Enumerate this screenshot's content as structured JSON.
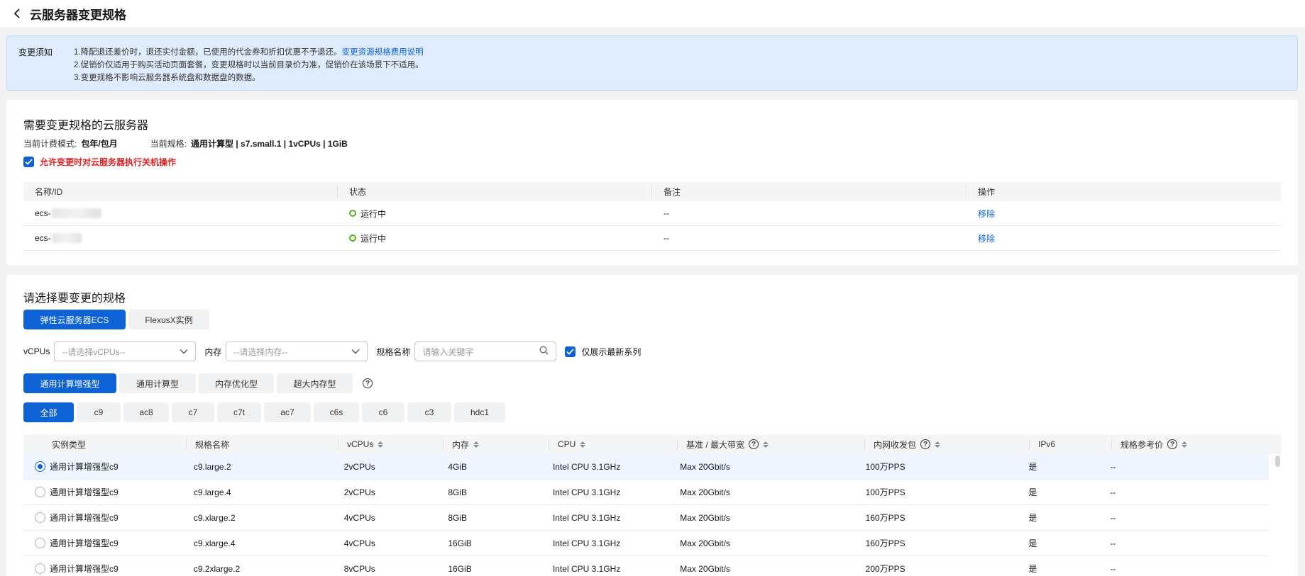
{
  "header": {
    "title": "云服务器变更规格"
  },
  "notice": {
    "label": "变更须知",
    "line1": "1.降配退还差价时，退还实付金额，已使用的代金券和折扣优惠不予退还。",
    "line1_link": "变更资源规格费用说明",
    "line2": "2.促销价仅适用于购买活动页面套餐，变更规格时以当前目录价为准，促销价在该场景下不适用。",
    "line3": "3.变更规格不影响云服务器系统盘和数据盘的数据。"
  },
  "servers_section": {
    "title": "需要变更规格的云服务器",
    "billing_label": "当前计费模式:",
    "billing_value": "包年/包月",
    "spec_label": "当前规格:",
    "spec_value": "通用计算型 | s7.small.1 | 1vCPUs | 1GiB",
    "allow_shutdown": "允许变更时对云服务器执行关机操作",
    "columns": [
      "名称/ID",
      "状态",
      "备注",
      "操作"
    ],
    "rows": [
      {
        "name": "ecs-",
        "status": "运行中",
        "remark": "--",
        "action": "移除"
      },
      {
        "name": "ecs-",
        "status": "运行中",
        "remark": "--",
        "action": "移除"
      }
    ]
  },
  "spec_section": {
    "title": "请选择要变更的规格",
    "product_tabs": [
      "弹性云服务器ECS",
      "FlexusX实例"
    ],
    "filters": {
      "vcpu_label": "vCPUs",
      "vcpu_placeholder": "--请选择vCPUs--",
      "memory_label": "内存",
      "memory_placeholder": "--请选择内存--",
      "name_label": "规格名称",
      "name_placeholder": "请输入关键字",
      "latest_only": "仅展示最新系列"
    },
    "type_tabs": [
      "通用计算增强型",
      "通用计算型",
      "内存优化型",
      "超大内存型"
    ],
    "series_tabs": [
      "全部",
      "c9",
      "ac8",
      "c7",
      "c7t",
      "ac7",
      "c6s",
      "c6",
      "c3",
      "hdc1"
    ],
    "columns": [
      "实例类型",
      "规格名称",
      "vCPUs",
      "内存",
      "CPU",
      "基准 / 最大带宽",
      "内网收发包",
      "IPv6",
      "规格参考价"
    ],
    "rows": [
      {
        "type": "通用计算增强型c9",
        "name": "c9.large.2",
        "vcpus": "2vCPUs",
        "memory": "4GiB",
        "cpu": "Intel CPU 3.1GHz",
        "bandwidth": "Max 20Gbit/s",
        "pps": "100万PPS",
        "ipv6": "是",
        "price": "--",
        "selected": true
      },
      {
        "type": "通用计算增强型c9",
        "name": "c9.large.4",
        "vcpus": "2vCPUs",
        "memory": "8GiB",
        "cpu": "Intel CPU 3.1GHz",
        "bandwidth": "Max 20Gbit/s",
        "pps": "100万PPS",
        "ipv6": "是",
        "price": "--",
        "selected": false
      },
      {
        "type": "通用计算增强型c9",
        "name": "c9.xlarge.2",
        "vcpus": "4vCPUs",
        "memory": "8GiB",
        "cpu": "Intel CPU 3.1GHz",
        "bandwidth": "Max 20Gbit/s",
        "pps": "160万PPS",
        "ipv6": "是",
        "price": "--",
        "selected": false
      },
      {
        "type": "通用计算增强型c9",
        "name": "c9.xlarge.4",
        "vcpus": "4vCPUs",
        "memory": "16GiB",
        "cpu": "Intel CPU 3.1GHz",
        "bandwidth": "Max 20Gbit/s",
        "pps": "160万PPS",
        "ipv6": "是",
        "price": "--",
        "selected": false
      },
      {
        "type": "通用计算增强型c9",
        "name": "c9.2xlarge.2",
        "vcpus": "8vCPUs",
        "memory": "16GiB",
        "cpu": "Intel CPU 3.1GHz",
        "bandwidth": "Max 20Gbit/s",
        "pps": "200万PPS",
        "ipv6": "是",
        "price": "--",
        "selected": false
      }
    ]
  },
  "colors": {
    "primary": "#0d62d6",
    "warning_text": "#e02020",
    "running": "#5ab020",
    "notice_bg": "#deecfd"
  }
}
